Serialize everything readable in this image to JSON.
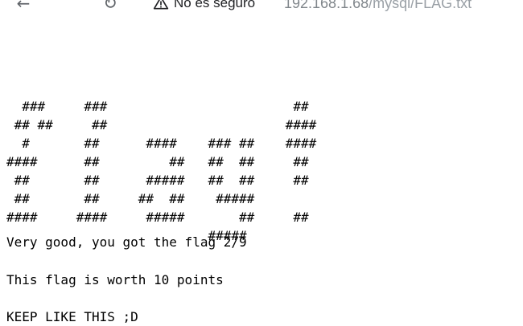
{
  "browser": {
    "back_icon": "arrow-left-icon",
    "reload_icon": "reload-icon",
    "security_icon": "warning-triangle-icon",
    "security_label": "No es seguro",
    "url_host": "192.168.1.68",
    "url_path": "/mysql/FLAG.txt"
  },
  "document": {
    "ascii_art": "  ###     ###                        ##\n ## ##     ##                       ####\n  #       ##      ####    ### ##    ####\n####      ##         ##   ##  ##     ##\n ##       ##      #####   ##  ##     ##\n ##       ##     ##  ##    #####\n####     ####     #####       ##     ##\n                          #####",
    "lines": [
      "Very good, you got the flag 2/9",
      "This flag is worth 10 points",
      "KEEP LIKE THIS ;D"
    ]
  }
}
